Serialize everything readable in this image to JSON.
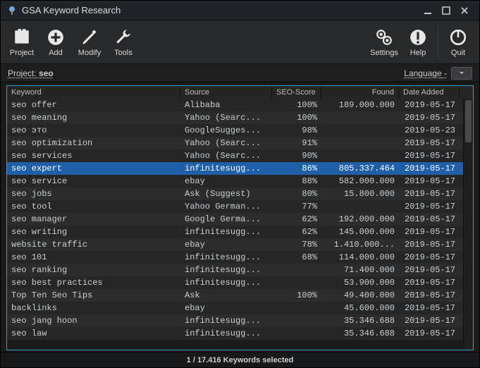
{
  "window": {
    "title": "GSA Keyword Research"
  },
  "toolbar": {
    "project": "Project",
    "add": "Add",
    "modify": "Modify",
    "tools": "Tools",
    "settings": "Settings",
    "help": "Help",
    "quit": "Quit"
  },
  "subbar": {
    "project_label": "Project:",
    "project_name": "seo",
    "language_label": "Language",
    "language_value": "-"
  },
  "columns": {
    "keyword": "Keyword",
    "source": "Source",
    "score": "SEO-Score",
    "found": "Found",
    "date": "Date Added"
  },
  "rows": [
    {
      "keyword": "seo offer",
      "source": "Alibaba",
      "score": "100%",
      "found": "189.000.000",
      "date": "2019-05-17",
      "selected": false
    },
    {
      "keyword": "seo meaning",
      "source": "Yahoo (Searc...",
      "score": "100%",
      "found": "",
      "date": "2019-05-17",
      "selected": false
    },
    {
      "keyword": "seo это",
      "source": "GoogleSugges...",
      "score": "98%",
      "found": "",
      "date": "2019-05-23",
      "selected": false
    },
    {
      "keyword": "seo optimization",
      "source": "Yahoo (Searc...",
      "score": "91%",
      "found": "",
      "date": "2019-05-17",
      "selected": false
    },
    {
      "keyword": "seo services",
      "source": "Yahoo (Searc...",
      "score": "90%",
      "found": "",
      "date": "2019-05-17",
      "selected": false
    },
    {
      "keyword": "seo expert",
      "source": "infinitesugg...",
      "score": "86%",
      "found": "805.337.464",
      "date": "2019-05-17",
      "selected": true
    },
    {
      "keyword": "seo service",
      "source": "ebay",
      "score": "88%",
      "found": "582.000.000",
      "date": "2019-05-17",
      "selected": false
    },
    {
      "keyword": "seo jobs",
      "source": "Ask (Suggest)",
      "score": "80%",
      "found": "15.800.000",
      "date": "2019-05-17",
      "selected": false
    },
    {
      "keyword": "seo tool",
      "source": "Yahoo German...",
      "score": "77%",
      "found": "",
      "date": "2019-05-17",
      "selected": false
    },
    {
      "keyword": "seo manager",
      "source": "Google Germa...",
      "score": "62%",
      "found": "192.000.000",
      "date": "2019-05-17",
      "selected": false
    },
    {
      "keyword": "seo writing",
      "source": "infinitesugg...",
      "score": "62%",
      "found": "145.000.000",
      "date": "2019-05-17",
      "selected": false
    },
    {
      "keyword": "website traffic",
      "source": "ebay",
      "score": "78%",
      "found": "1.410.000...",
      "date": "2019-05-17",
      "selected": false
    },
    {
      "keyword": "seo 101",
      "source": "infinitesugg...",
      "score": "68%",
      "found": "114.000.000",
      "date": "2019-05-17",
      "selected": false
    },
    {
      "keyword": "seo ranking",
      "source": "infinitesugg...",
      "score": "",
      "found": "71.400.000",
      "date": "2019-05-17",
      "selected": false
    },
    {
      "keyword": "seo best practices",
      "source": "infinitesugg...",
      "score": "",
      "found": "53.900.000",
      "date": "2019-05-17",
      "selected": false
    },
    {
      "keyword": "Top Ten Seo Tips",
      "source": "Ask",
      "score": "100%",
      "found": "49.400.000",
      "date": "2019-05-17",
      "selected": false
    },
    {
      "keyword": "backlinks",
      "source": "ebay",
      "score": "",
      "found": "45.600.000",
      "date": "2019-05-17",
      "selected": false
    },
    {
      "keyword": "seo jang hoon",
      "source": "infinitesugg...",
      "score": "",
      "found": "35.346.688",
      "date": "2019-05-17",
      "selected": false
    },
    {
      "keyword": "seo law",
      "source": "infinitesugg...",
      "score": "",
      "found": "35.346.688",
      "date": "2019-05-17",
      "selected": false
    }
  ],
  "status": "1 / 17.416 Keywords selected"
}
